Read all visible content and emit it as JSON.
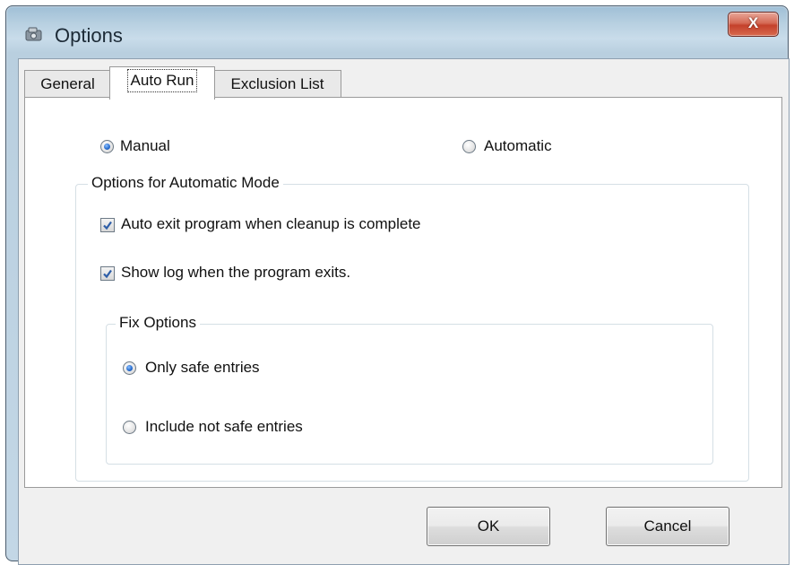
{
  "window": {
    "title": "Options",
    "close_glyph": "X",
    "icon": "options-app-icon"
  },
  "tabs": [
    {
      "label": "General",
      "selected": false
    },
    {
      "label": "Auto Run",
      "selected": true
    },
    {
      "label": "Exclusion List",
      "selected": false
    }
  ],
  "mode": {
    "manual_label": "Manual",
    "manual_checked": true,
    "automatic_label": "Automatic",
    "automatic_checked": false
  },
  "automatic_group": {
    "title": "Options for Automatic Mode",
    "auto_exit_label": "Auto exit program when cleanup is complete",
    "auto_exit_checked": true,
    "show_log_label": "Show log when the program exits.",
    "show_log_checked": true
  },
  "fix_group": {
    "title": "Fix Options",
    "only_safe_label": "Only safe entries",
    "only_safe_checked": true,
    "include_unsafe_label": "Include not safe entries",
    "include_unsafe_checked": false
  },
  "buttons": {
    "ok_label": "OK",
    "cancel_label": "Cancel"
  },
  "colors": {
    "title_bar": "#b6cfe0",
    "close_button": "#c4412b",
    "radio_accent": "#2a6fd0"
  }
}
